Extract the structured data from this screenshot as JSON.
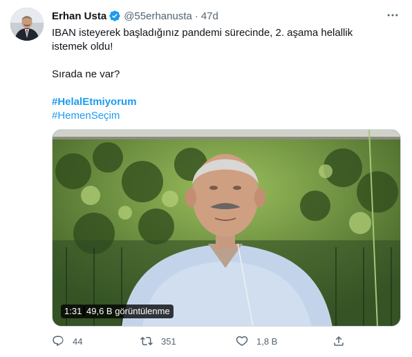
{
  "tweet": {
    "author_name": "Erhan Usta",
    "handle": "@55erhanusta",
    "separator": "·",
    "time": "47d",
    "text_line1": "IBAN isteyerek başladığınız pandemi sürecinde, 2. aşama helallik istemek oldu!",
    "text_line2": "Sırada ne var?",
    "hashtags": [
      "#HelalEtmiyorum",
      "#HemenSeçim"
    ]
  },
  "media": {
    "duration": "1:31",
    "views": "49,6 B görüntülenme"
  },
  "actions": {
    "reply_count": "44",
    "retweet_count": "351",
    "like_count": "1,8 B",
    "share_count": ""
  },
  "icons": {
    "verified": "verified-badge-icon",
    "more": "more-horizontal-icon",
    "reply": "reply-icon",
    "retweet": "retweet-icon",
    "like": "heart-icon",
    "share": "share-icon"
  },
  "colors": {
    "accent": "#1d9bf0",
    "secondary_text": "#536471",
    "primary_text": "#0f1419"
  }
}
